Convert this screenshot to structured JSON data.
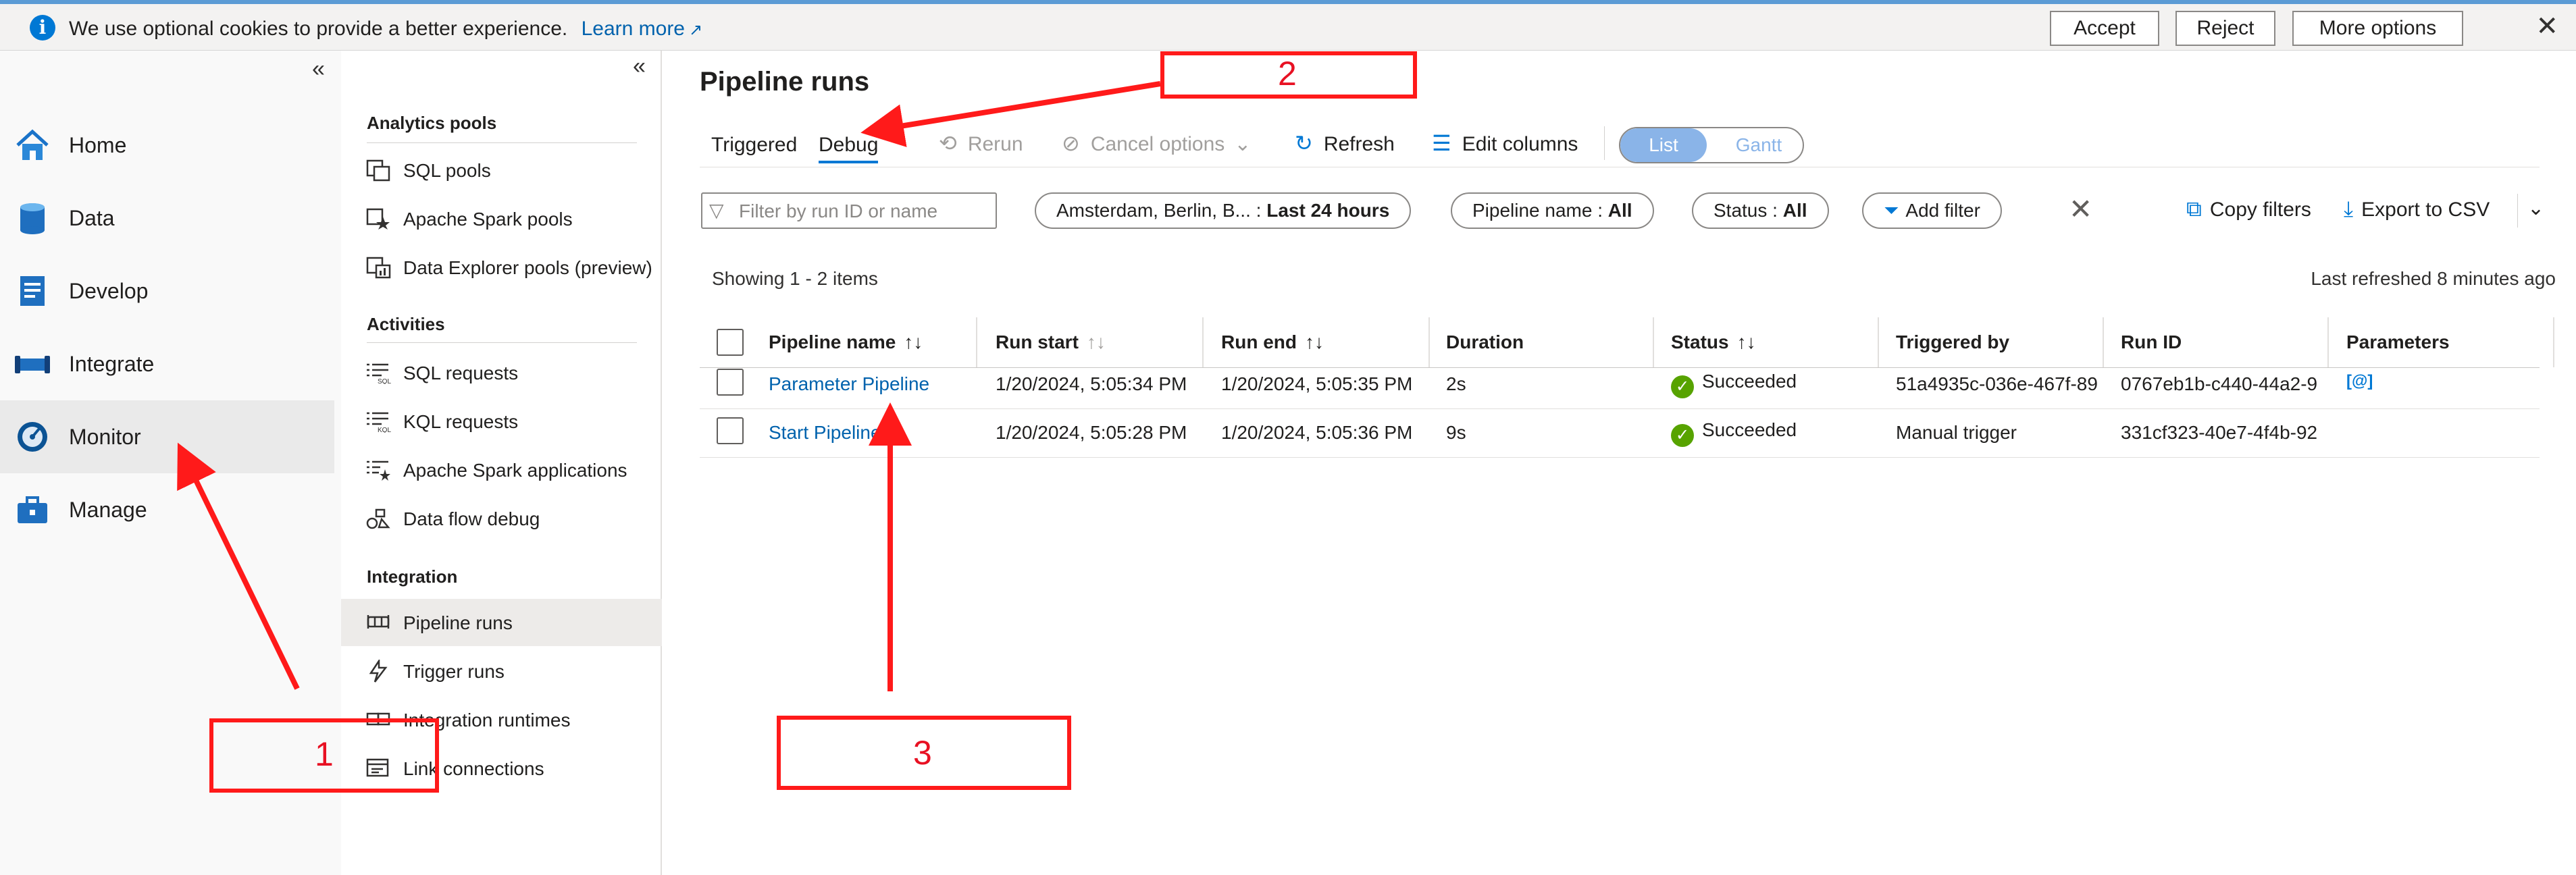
{
  "cookie_banner": {
    "message": "We use optional cookies to provide a better experience.",
    "learn_more": "Learn more",
    "accept": "Accept",
    "reject": "Reject",
    "more_options": "More options"
  },
  "nav": {
    "items": [
      {
        "label": "Home",
        "icon": "home-icon"
      },
      {
        "label": "Data",
        "icon": "database-icon"
      },
      {
        "label": "Develop",
        "icon": "document-icon"
      },
      {
        "label": "Integrate",
        "icon": "pipeline-icon"
      },
      {
        "label": "Monitor",
        "icon": "gauge-icon",
        "selected": true
      },
      {
        "label": "Manage",
        "icon": "toolbox-icon"
      }
    ]
  },
  "subnav": {
    "analytics_pools": "Analytics pools",
    "sql_pools": "SQL pools",
    "apache_spark_pools": "Apache Spark pools",
    "data_explorer_pools": "Data Explorer pools (preview)",
    "activities": "Activities",
    "sql_requests": "SQL requests",
    "kql_requests": "KQL requests",
    "apache_spark_applications": "Apache Spark applications",
    "data_flow_debug": "Data flow debug",
    "integration": "Integration",
    "pipeline_runs": "Pipeline runs",
    "trigger_runs": "Trigger runs",
    "integration_runtimes": "Integration runtimes",
    "link_connections": "Link connections"
  },
  "main": {
    "title": "Pipeline runs",
    "tabs": {
      "triggered": "Triggered",
      "debug": "Debug"
    },
    "toolbar": {
      "rerun": "Rerun",
      "cancel_options": "Cancel options",
      "refresh": "Refresh",
      "edit_columns": "Edit columns",
      "list": "List",
      "gantt": "Gantt"
    },
    "filters": {
      "placeholder": "Filter by run ID or name",
      "timezone": "Amsterdam, Berlin, B...",
      "time_range_sep": " : ",
      "time_range": "Last 24 hours",
      "pipeline_name_label": "Pipeline name : ",
      "pipeline_name_value": "All",
      "status_label": "Status : ",
      "status_value": "All",
      "add_filter": "Add filter",
      "copy_filters": "Copy filters",
      "export_csv": "Export to CSV"
    },
    "showing": "Showing 1 - 2 items",
    "last_refreshed": "Last refreshed 8 minutes ago",
    "table": {
      "columns": [
        "Pipeline name",
        "Run start",
        "Run end",
        "Duration",
        "Status",
        "Triggered by",
        "Run ID",
        "Parameters"
      ],
      "rows": [
        {
          "name": "Parameter Pipeline",
          "run_start": "1/20/2024, 5:05:34 PM",
          "run_end": "1/20/2024, 5:05:35 PM",
          "duration": "2s",
          "status": "Succeeded",
          "triggered_by": "51a4935c-036e-467f-89",
          "run_id": "0767eb1b-c440-44a2-9",
          "parameters": "[@]"
        },
        {
          "name": "Start Pipeline",
          "run_start": "1/20/2024, 5:05:28 PM",
          "run_end": "1/20/2024, 5:05:36 PM",
          "duration": "9s",
          "status": "Succeeded",
          "triggered_by": "Manual trigger",
          "run_id": "331cf323-40e7-4f4b-92",
          "parameters": ""
        }
      ]
    }
  },
  "annotations": {
    "one": "1",
    "two": "2",
    "three": "3"
  },
  "colors": {
    "accent": "#0078d4",
    "success": "#57a300",
    "annotation": "#ff1a1a"
  }
}
